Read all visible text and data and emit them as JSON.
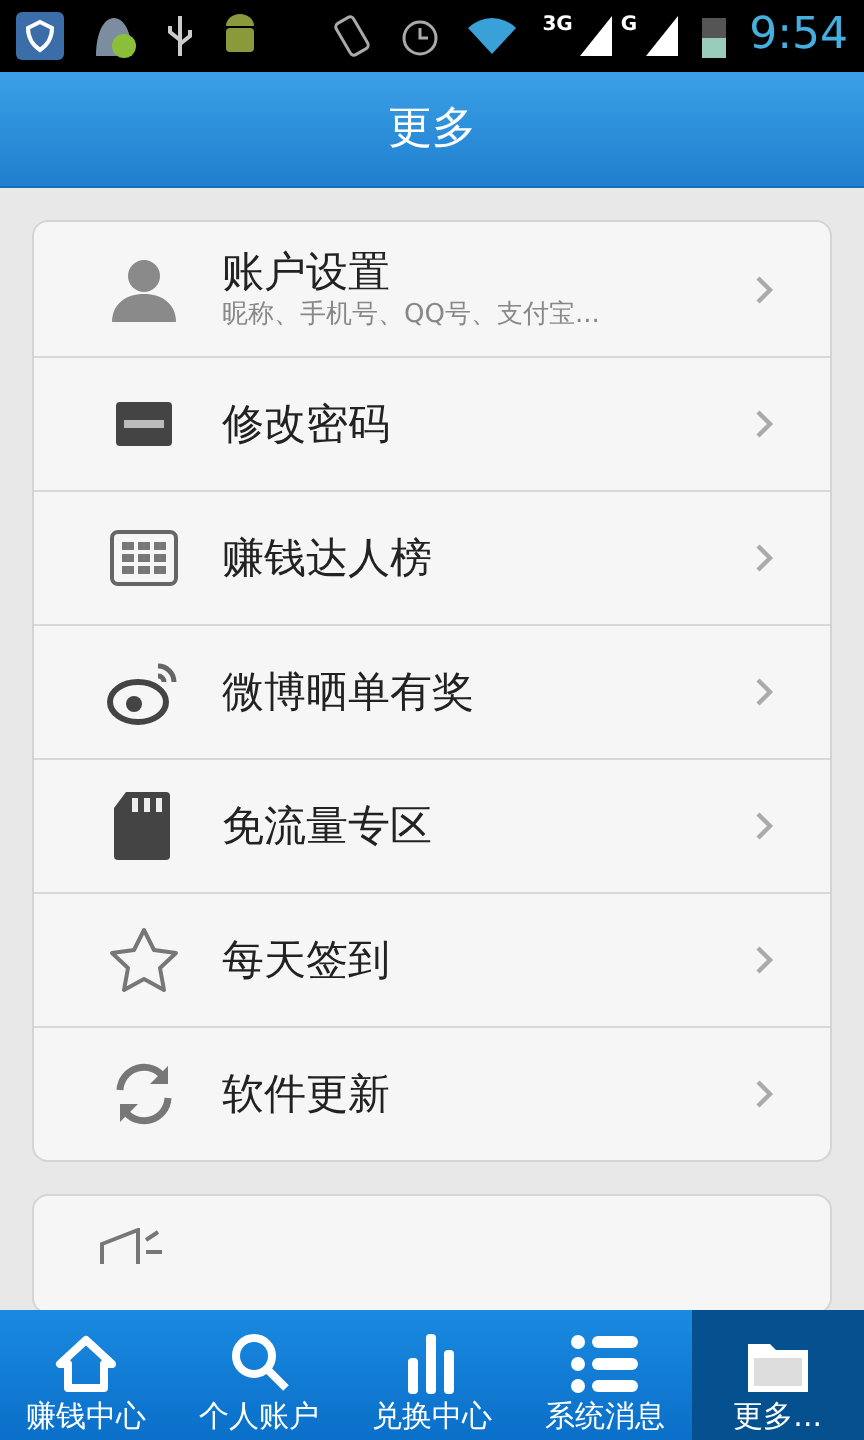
{
  "status_bar": {
    "network_1": "3G",
    "network_2": "G",
    "time": "9:54"
  },
  "header": {
    "title": "更多"
  },
  "menu": [
    {
      "label": "账户设置",
      "subtitle": "昵称、手机号、QQ号、支付宝..."
    },
    {
      "label": "修改密码"
    },
    {
      "label": "赚钱达人榜"
    },
    {
      "label": "微博晒单有奖"
    },
    {
      "label": "免流量专区"
    },
    {
      "label": "每天签到"
    },
    {
      "label": "软件更新"
    }
  ],
  "tabs": [
    {
      "label": "赚钱中心",
      "selected": false
    },
    {
      "label": "个人账户",
      "selected": false
    },
    {
      "label": "兑换中心",
      "selected": false
    },
    {
      "label": "系统消息",
      "selected": false
    },
    {
      "label": "更多...",
      "selected": true
    }
  ]
}
